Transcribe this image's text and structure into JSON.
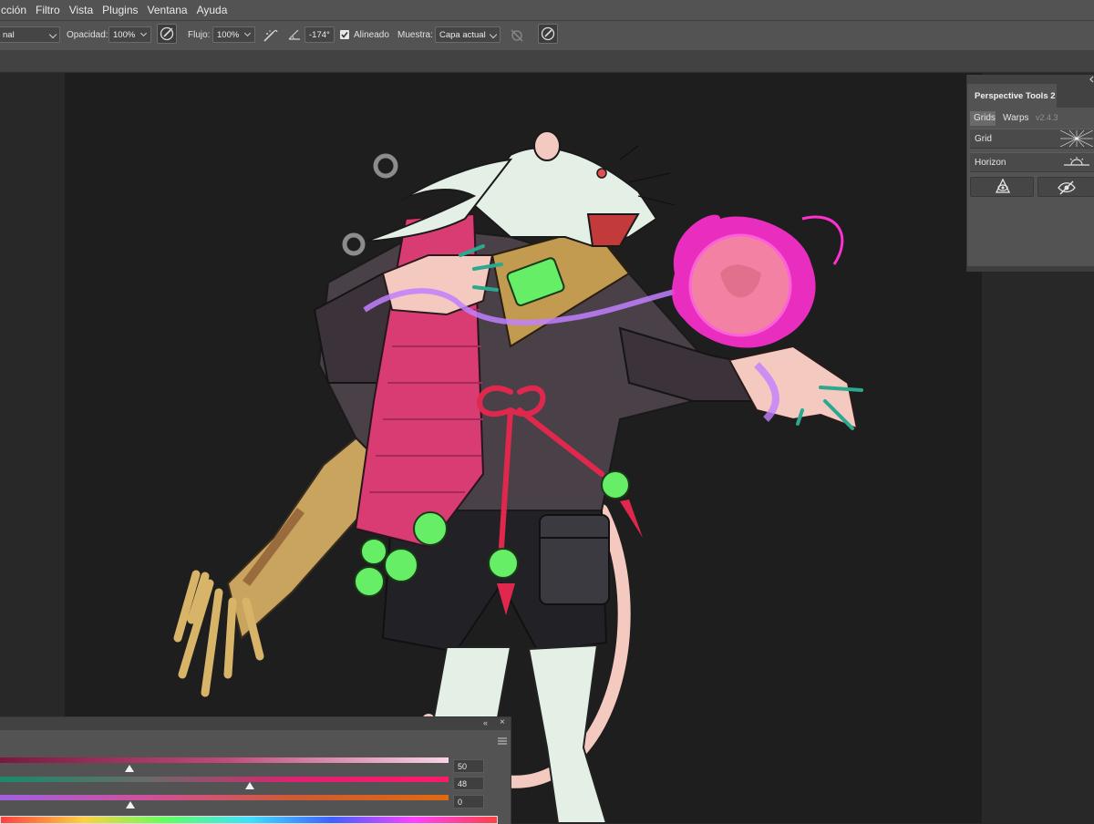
{
  "menu": {
    "items": [
      "cción",
      "Filtro",
      "Vista",
      "Plugins",
      "Ventana",
      "Ayuda"
    ]
  },
  "options": {
    "blend_mode": "nal",
    "opacity_label": "Opacidad:",
    "opacity_value": "100%",
    "flow_label": "Flujo:",
    "flow_value": "100%",
    "angle_value": "-174°",
    "aligned_label": "Alineado",
    "aligned_checked": true,
    "sample_label": "Muestra:",
    "sample_value": "Capa actual"
  },
  "perspective_panel": {
    "title": "Perspective Tools 2",
    "tabs": [
      "Grids",
      "Warps"
    ],
    "version": "v2.4.3",
    "rows": [
      "Grid",
      "Horizon"
    ]
  },
  "color_panel": {
    "values": [
      "50",
      "48",
      "0"
    ]
  },
  "colors": {
    "ui_bg": "#535353",
    "canvas_bg": "#1e1e1e",
    "magic_pink": "#ff30d0",
    "skull_green": "#66ee66",
    "robe_pink": "#d83c72"
  },
  "icons": {
    "brush_settings": "airbrush-circle-icon",
    "airbrush": "airbrush-icon",
    "angle": "angle-icon",
    "ignore_adjustments": "ignore-adjustment-icon",
    "pressure": "pressure-size-icon"
  }
}
